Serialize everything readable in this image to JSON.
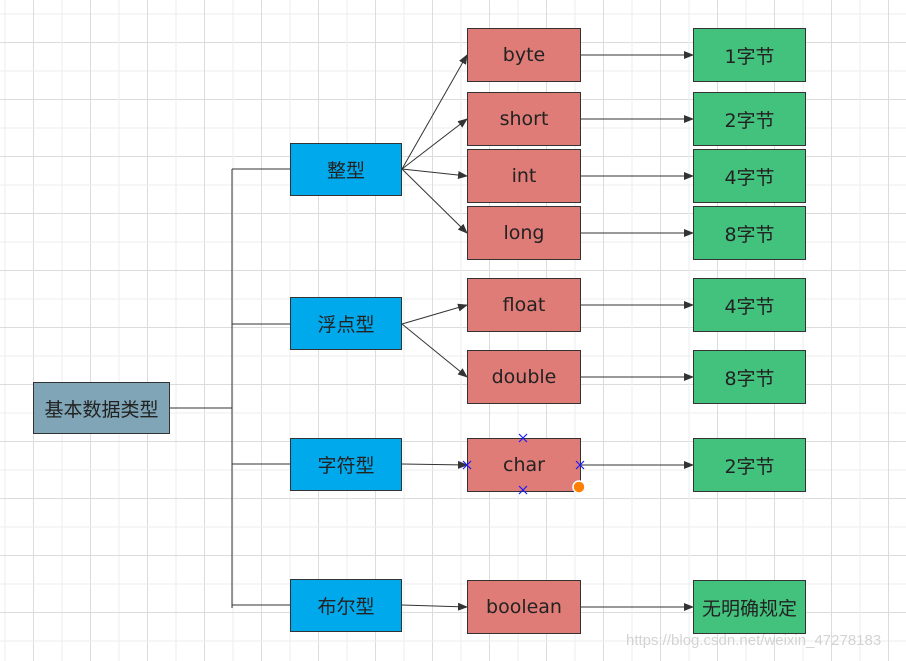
{
  "root": {
    "label": "基本数据类型"
  },
  "categories": [
    {
      "label": "整型",
      "types": [
        {
          "name": "byte",
          "size": "1字节"
        },
        {
          "name": "short",
          "size": "2字节"
        },
        {
          "name": "int",
          "size": "4字节"
        },
        {
          "name": "long",
          "size": "8字节"
        }
      ]
    },
    {
      "label": "浮点型",
      "types": [
        {
          "name": "float",
          "size": "4字节"
        },
        {
          "name": "double",
          "size": "8字节"
        }
      ]
    },
    {
      "label": "字符型",
      "types": [
        {
          "name": "char",
          "size": "2字节"
        }
      ]
    },
    {
      "label": "布尔型",
      "types": [
        {
          "name": "boolean",
          "size": "无明确规定"
        }
      ]
    }
  ],
  "watermark": "https://blog.csdn.net/weixin_47278183",
  "colors": {
    "root": "#7fa5b6",
    "category": "#00a9ec",
    "type": "#df7c77",
    "size": "#43c27e"
  }
}
